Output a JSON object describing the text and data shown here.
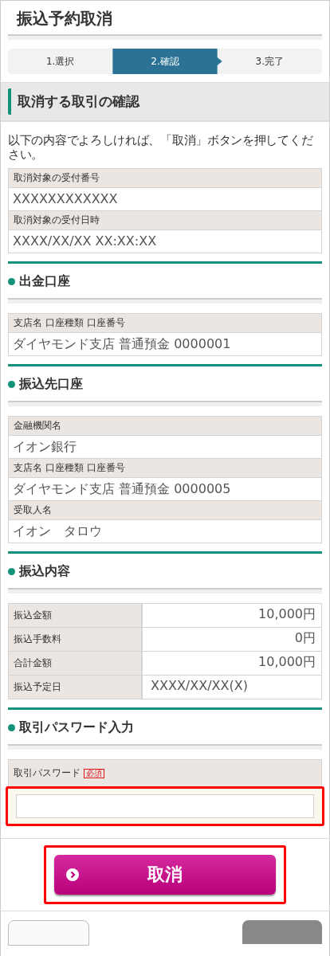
{
  "page_title": "振込予約取消",
  "steps": [
    {
      "label": "1.選択",
      "selected": false
    },
    {
      "label": "2.確認",
      "selected": true
    },
    {
      "label": "3.完了",
      "selected": false
    }
  ],
  "section_title": "取消する取引の確認",
  "intro": "以下の内容でよろしければ、「取消」ボタンを押してください。",
  "receipt": [
    {
      "label": "取消対象の受付番号",
      "value": "XXXXXXXXXXXX"
    },
    {
      "label": "取消対象の受付日時",
      "value": "XXXX/XX/XX XX:XX:XX"
    }
  ],
  "sections": [
    {
      "heading": "出金口座",
      "kind": "stacked",
      "rows": [
        {
          "label": "支店名 口座種類 口座番号",
          "value": "ダイヤモンド支店 普通預金 0000001"
        }
      ]
    },
    {
      "heading": "振込先口座",
      "kind": "stacked",
      "rows": [
        {
          "label": "金融機関名",
          "value": "イオン銀行"
        },
        {
          "label": "支店名 口座種類 口座番号",
          "value": "ダイヤモンド支店 普通預金 0000005"
        },
        {
          "label": "受取人名",
          "value": "イオン　タロウ"
        }
      ]
    },
    {
      "heading": "振込内容",
      "kind": "grid",
      "rows": [
        {
          "label": "振込金額",
          "value": "10,000円",
          "align_right": true
        },
        {
          "label": "振込手数料",
          "value": "0円",
          "align_right": true
        },
        {
          "label": "合計金額",
          "value": "10,000円",
          "align_right": true
        },
        {
          "label": "振込予定日",
          "value": "XXXX/XX/XX(X)",
          "align_right": false
        }
      ]
    },
    {
      "heading": "取引パスワード入力",
      "kind": "password",
      "field_label": "取引パスワード",
      "required_badge": "必須",
      "highlighted": true
    }
  ],
  "submit_button": {
    "label": "取消",
    "highlighted": true
  }
}
